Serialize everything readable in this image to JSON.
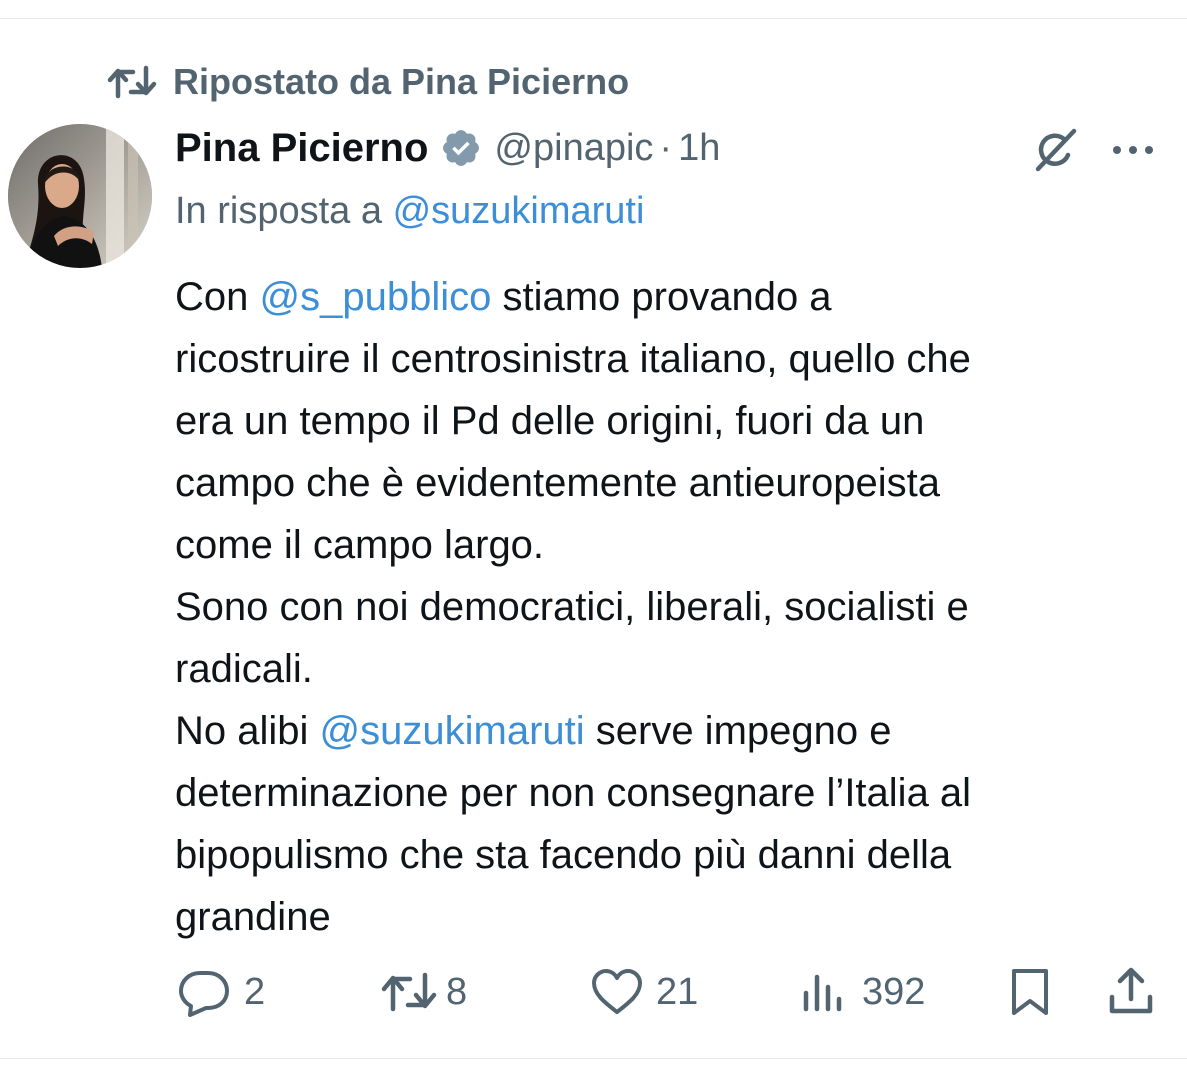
{
  "repost": {
    "icon": "repost-icon",
    "label": "Ripostato da Pina Picierno"
  },
  "author": {
    "name": "Pina Picierno",
    "verified_icon": "verified-badge-icon",
    "handle": "@pinapic",
    "separator": "·",
    "time": "1h",
    "avatar": "avatar-photo"
  },
  "reply": {
    "prefix": "In risposta a ",
    "mention": "@suzukimaruti"
  },
  "tweet": {
    "l1_a": "Con ",
    "l1_link": "@s_pubblico",
    "l1_b": " stiamo provando a",
    "l2": "ricostruire il centrosinistra italiano, quello che",
    "l3": "era un tempo il Pd delle origini, fuori da un",
    "l4": "campo che è evidentemente antieuropeista",
    "l5": "come il campo largo.",
    "l6": "Sono con noi democratici, liberali, socialisti e",
    "l7": "radicali.",
    "l8_a": "No alibi ",
    "l8_link": "@suzukimaruti",
    "l8_b": " serve impegno e",
    "l9": "determinazione per non consegnare l’Italia al",
    "l10": "bipopulismo che sta facendo più danni della",
    "l11": "grandine"
  },
  "actions": {
    "replies": "2",
    "reposts": "8",
    "likes": "21",
    "views": "392"
  },
  "icons": [
    "grok-icon",
    "more-icon",
    "reply-icon",
    "repost-icon",
    "like-icon",
    "views-icon",
    "bookmark-icon",
    "share-icon"
  ],
  "colors": {
    "text": "#0f1419",
    "secondary": "#536471",
    "link": "#3c8fd6",
    "divider": "#e6e9ec"
  }
}
